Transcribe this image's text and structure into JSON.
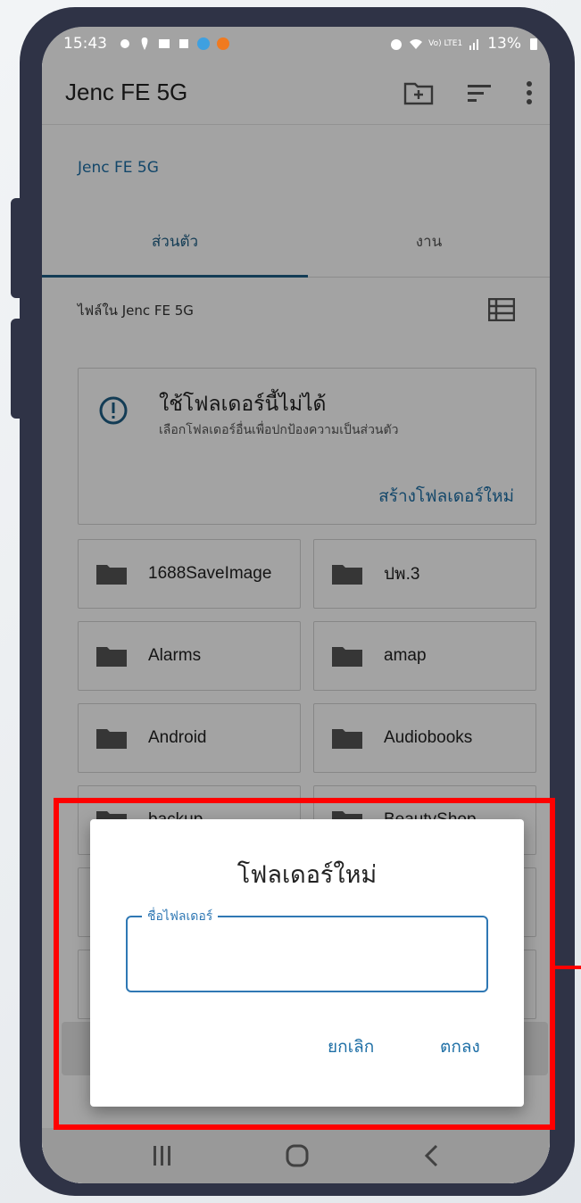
{
  "status": {
    "time": "15:43",
    "battery": "13%",
    "network": "Vo) LTE1"
  },
  "appbar": {
    "title": "Jenc FE 5G"
  },
  "breadcrumb": "Jenc FE 5G",
  "tabs": [
    {
      "label": "ส่วนตัว"
    },
    {
      "label": "งาน"
    }
  ],
  "files_label": "ไฟล์ใน Jenc FE 5G",
  "warning": {
    "title": "ใช้โฟลเดอร์นี้ไม่ได้",
    "subtitle": "เลือกโฟลเดอร์อื่นเพื่อปกป้องความเป็นส่วนตัว",
    "action": "สร้างโฟลเดอร์ใหม่"
  },
  "folders": [
    "1688SaveImage",
    "ปพ.3",
    "Alarms",
    "amap",
    "Android",
    "Audiobooks",
    "backup",
    "BeautyShop"
  ],
  "dialog": {
    "title": "โฟลเดอร์ใหม่",
    "field_label": "ชื่อไฟลเดอร์",
    "field_value": "",
    "cancel": "ยกเลิก",
    "ok": "ตกลง"
  },
  "colors": {
    "accent": "#1e6fa6",
    "highlight": "#ff0000",
    "frame": "#2f3346"
  }
}
